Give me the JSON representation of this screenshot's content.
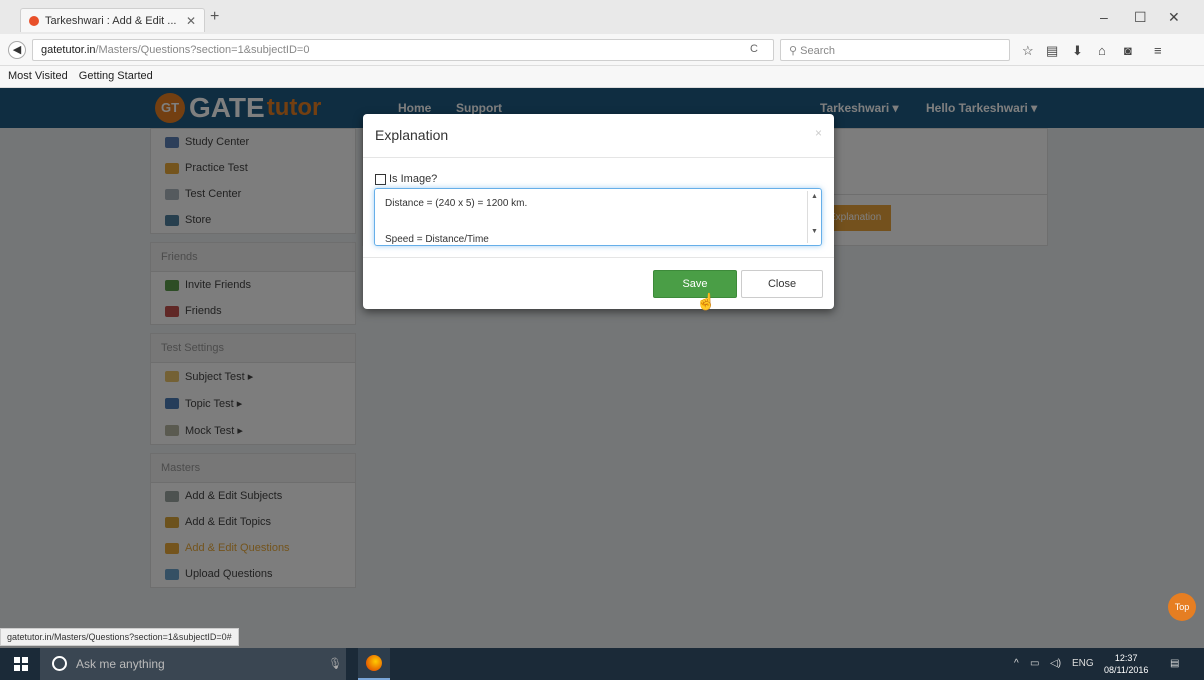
{
  "browser": {
    "tab_title": "Tarkeshwari : Add & Edit ...",
    "url_domain": "gatetutor.in",
    "url_path": "/Masters/Questions?section=1&subjectID=0",
    "search_placeholder": "Search",
    "bookmarks": [
      "Most Visited",
      "Getting Started"
    ],
    "status_url": "gatetutor.in/Masters/Questions?section=1&subjectID=0#"
  },
  "site": {
    "logo_badge": "GT",
    "logo_gate": "GATE",
    "logo_tutor": "tutor",
    "nav": [
      "Home",
      "Support"
    ],
    "user_menu": "Tarkeshwari ▾",
    "greeting": "Hello Tarkeshwari ▾",
    "orange_button": "Explanation",
    "top_button": "Top"
  },
  "sidebar": {
    "groups": [
      {
        "heading": "",
        "items": [
          "Study Center",
          "Practice Test",
          "Test Center",
          "Store"
        ]
      },
      {
        "heading": "Friends",
        "items": [
          "Invite Friends",
          "Friends"
        ]
      },
      {
        "heading": "Test Settings",
        "items": [
          "Subject Test ▸",
          "Topic Test ▸",
          "Mock Test ▸"
        ]
      },
      {
        "heading": "Masters",
        "items": [
          "Add & Edit Subjects",
          "Add & Edit Topics",
          "Add & Edit Questions",
          "Upload Questions"
        ]
      }
    ]
  },
  "modal": {
    "title": "Explanation",
    "close_x": "×",
    "checkbox_label": "Is Image?",
    "text_lines": [
      "Distance = (240 x 5) = 1200 km.",
      "",
      "Speed = Distance/Time"
    ],
    "save_label": "Save",
    "close_label": "Close"
  },
  "taskbar": {
    "search_placeholder": "Ask me anything",
    "language": "ENG",
    "time": "12:37",
    "date": "08/11/2016"
  }
}
